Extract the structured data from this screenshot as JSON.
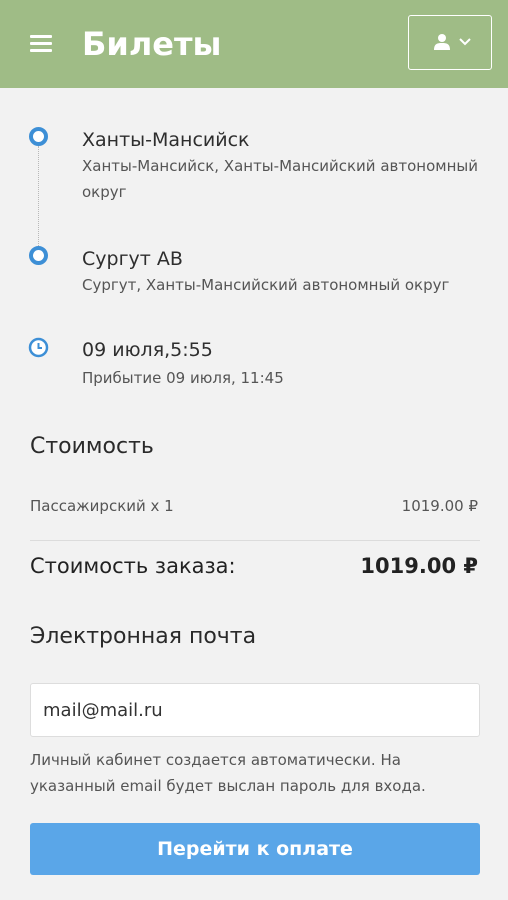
{
  "header": {
    "title": "Билеты",
    "background": "#9fbc86"
  },
  "route": {
    "departure": {
      "name": "Ханты-Мансийск",
      "address": "Ханты-Мансийск, Ханты-Мансийский автономный округ"
    },
    "arrival": {
      "name": "Сургут АВ",
      "address": "Сургут, Ханты-Мансийский автономный округ"
    },
    "time": {
      "departure": "09 июля,5:55",
      "arrival": "Прибытие 09 июля, 11:45"
    },
    "marker_color": "#3d8fd6"
  },
  "cost": {
    "title": "Стоимость",
    "items": [
      {
        "label": "Пассажирский x 1",
        "value": "1019.00 ₽"
      }
    ],
    "total_label": "Стоимость заказа:",
    "total_value": "1019.00 ₽"
  },
  "email": {
    "title": "Электронная почта",
    "value": "mail@mail.ru",
    "hint": "Личный кабинет создается автоматически. На указанный email будет выслан пароль для входа."
  },
  "pay_button": {
    "label": "Перейти к оплате",
    "color": "#5aa6e8"
  },
  "icons": {
    "menu": "menu-icon",
    "user": "user-icon",
    "chevron": "chevron-down-icon",
    "clock": "clock-icon",
    "stop": "route-stop-icon"
  }
}
